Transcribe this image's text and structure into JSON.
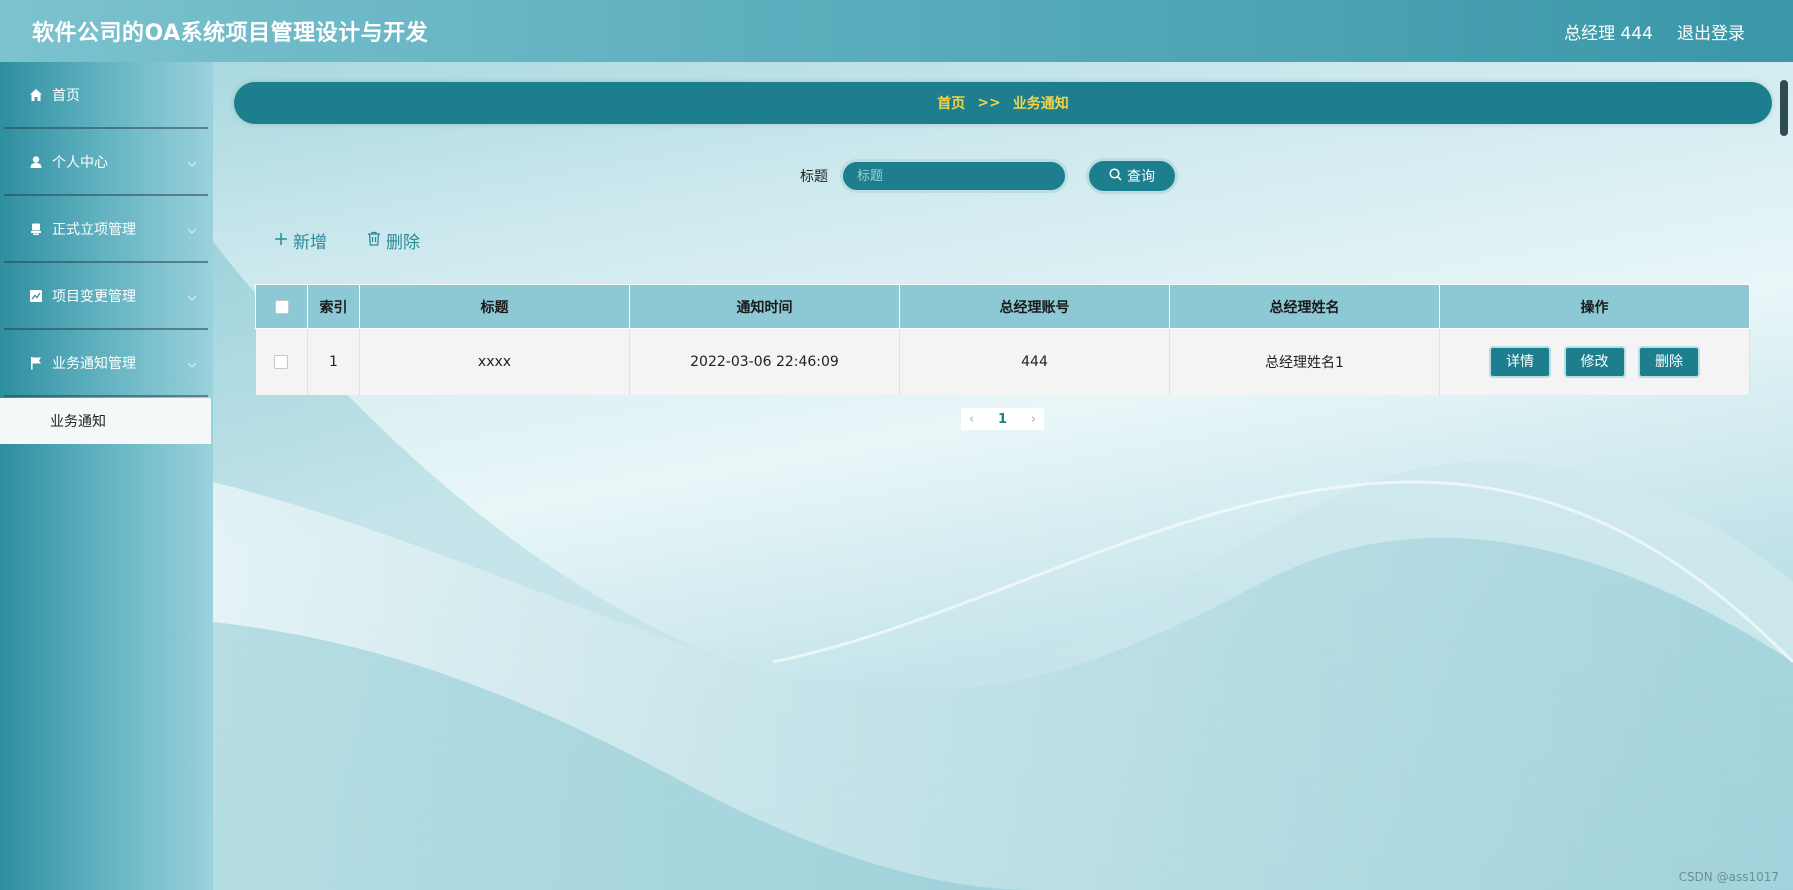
{
  "header": {
    "app_title": "软件公司的OA系统项目管理设计与开发",
    "user_label": "总经理 444",
    "logout_label": "退出登录"
  },
  "sidebar": {
    "items": [
      {
        "label": "首页",
        "icon": "home-icon",
        "has_chevron": false
      },
      {
        "label": "个人中心",
        "icon": "user-icon",
        "has_chevron": true
      },
      {
        "label": "正式立项管理",
        "icon": "stamp-icon",
        "has_chevron": true
      },
      {
        "label": "项目变更管理",
        "icon": "chart-icon",
        "has_chevron": true
      },
      {
        "label": "业务通知管理",
        "icon": "flag-icon",
        "has_chevron": true
      }
    ],
    "active_sub_item": "业务通知"
  },
  "breadcrumb": {
    "home": "首页",
    "separator": ">>",
    "current": "业务通知"
  },
  "search": {
    "label": "标题",
    "placeholder": "标题",
    "button_label": "查询"
  },
  "actions": {
    "add_label": "新增",
    "delete_label": "删除"
  },
  "table": {
    "columns": [
      "索引",
      "标题",
      "通知时间",
      "总经理账号",
      "总经理姓名",
      "操作"
    ],
    "rows": [
      {
        "index": "1",
        "title": "xxxx",
        "time": "2022-03-06 22:46:09",
        "account": "444",
        "name": "总经理姓名1"
      }
    ],
    "row_buttons": {
      "detail": "详情",
      "edit": "修改",
      "delete": "删除"
    }
  },
  "pagination": {
    "current_page": "1",
    "prev": "‹",
    "next": "›"
  },
  "watermark": "CSDN @ass1017",
  "colors": {
    "primary": "#1d7f8e",
    "header_bg": "#5fb0bf",
    "breadcrumb_text": "#f1d24b",
    "table_header": "#8dc9d5"
  }
}
